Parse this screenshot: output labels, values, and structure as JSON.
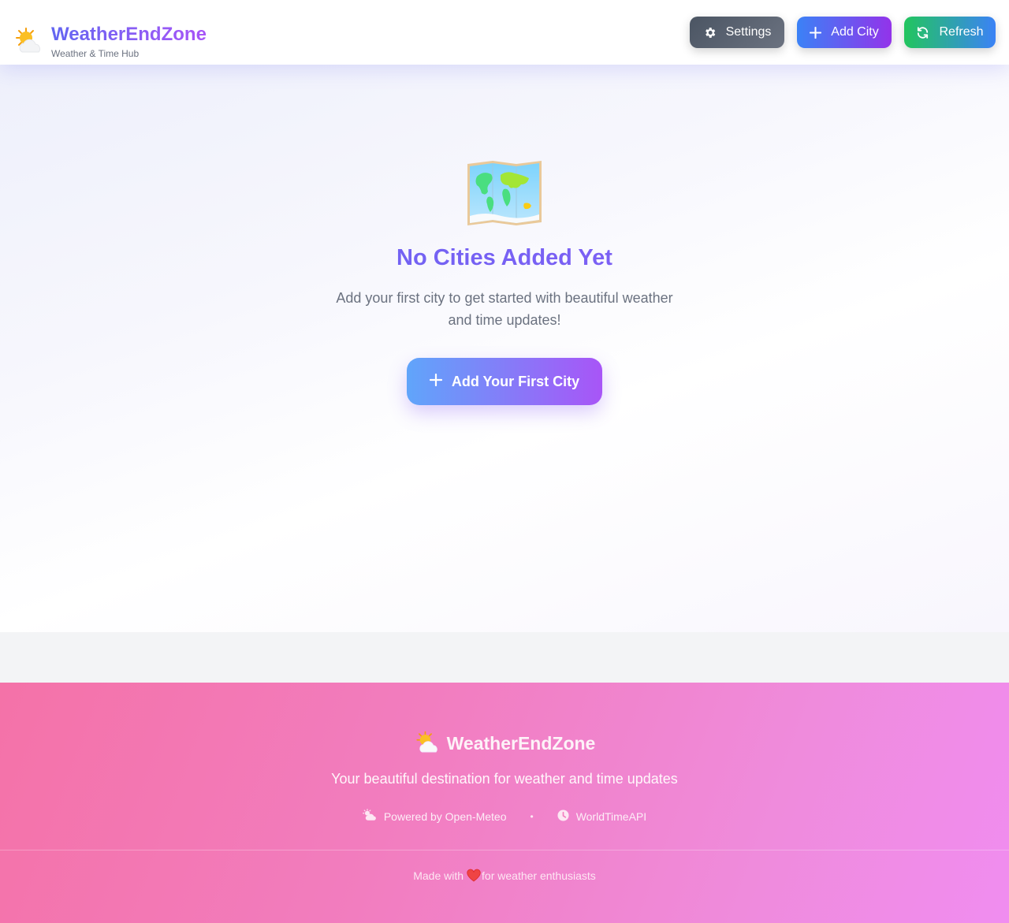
{
  "header": {
    "app_name": "WeatherEndZone",
    "subtitle": "Weather & Time Hub",
    "buttons": {
      "settings": "Settings",
      "add_city": "Add City",
      "refresh": "Refresh"
    }
  },
  "empty_state": {
    "title": "No Cities Added Yet",
    "description": "Add your first city to get started with beautiful weather and time updates!",
    "cta": "Add Your First City",
    "icon": "world-map-icon"
  },
  "footer": {
    "app_name": "WeatherEndZone",
    "tagline": "Your beautiful destination for weather and time updates",
    "links": [
      {
        "label": "Powered by Open-Meteo",
        "icon": "cloud-sun-icon"
      },
      {
        "label": "WorldTimeAPI",
        "icon": "clock-icon"
      }
    ],
    "separator": "•",
    "made_with_prefix": "Made with",
    "made_with_suffix": "for weather enthusiasts"
  },
  "colors": {
    "brand_gradient_start": "#6366f1",
    "brand_gradient_end": "#a855f7",
    "settings_button": "#4b5563",
    "add_city_button_start": "#3b82f6",
    "add_city_button_end": "#9333ea",
    "refresh_button_start": "#22c55e",
    "refresh_button_end": "#3b82f6",
    "footer_start": "#f472a8",
    "footer_end": "#f08df0"
  }
}
